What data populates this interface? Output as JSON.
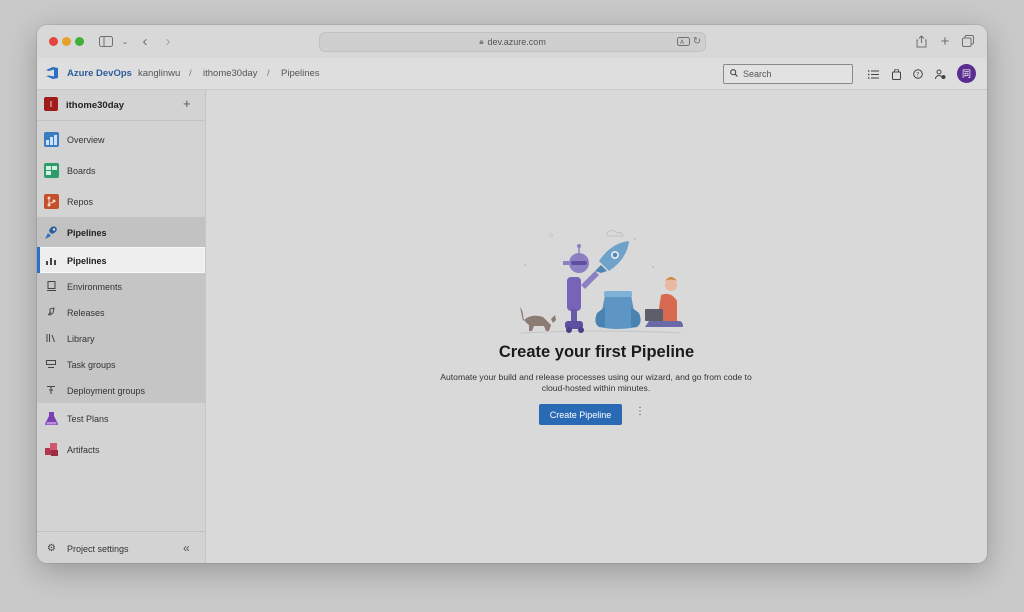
{
  "browser": {
    "url": "dev.azure.com"
  },
  "header": {
    "brand": "Azure DevOps",
    "breadcrumb": [
      "kanglinwu",
      "ithome30day",
      "Pipelines"
    ],
    "breadcrumb_separator": "/",
    "search_placeholder": "Search",
    "avatar_initial": "同"
  },
  "sidebar": {
    "project_initial": "I",
    "project_name": "ithome30day",
    "add_label": "+",
    "items": [
      {
        "label": "Overview",
        "icon": "overview-icon"
      },
      {
        "label": "Boards",
        "icon": "boards-icon"
      },
      {
        "label": "Repos",
        "icon": "repos-icon"
      },
      {
        "label": "Pipelines",
        "icon": "pipelines-icon"
      }
    ],
    "sub_items": [
      {
        "label": "Pipelines",
        "icon": "pipelines-sub-icon",
        "selected": true
      },
      {
        "label": "Environments",
        "icon": "environments-icon"
      },
      {
        "label": "Releases",
        "icon": "releases-icon"
      },
      {
        "label": "Library",
        "icon": "library-icon"
      },
      {
        "label": "Task groups",
        "icon": "task-groups-icon"
      },
      {
        "label": "Deployment groups",
        "icon": "deployment-groups-icon"
      }
    ],
    "items_after": [
      {
        "label": "Test Plans",
        "icon": "test-plans-icon"
      },
      {
        "label": "Artifacts",
        "icon": "artifacts-icon"
      }
    ],
    "footer_label": "Project settings",
    "collapse_glyph": "«"
  },
  "main": {
    "title": "Create your first Pipeline",
    "description": "Automate your build and release processes using our wizard, and go from code to cloud-hosted within minutes.",
    "cta_label": "Create Pipeline",
    "more_glyph": "⋮"
  },
  "colors": {
    "accent": "#2a6ab5",
    "brand": "#2b5d9c",
    "avatar": "#5b2d90",
    "project_badge": "#a01b1b"
  }
}
